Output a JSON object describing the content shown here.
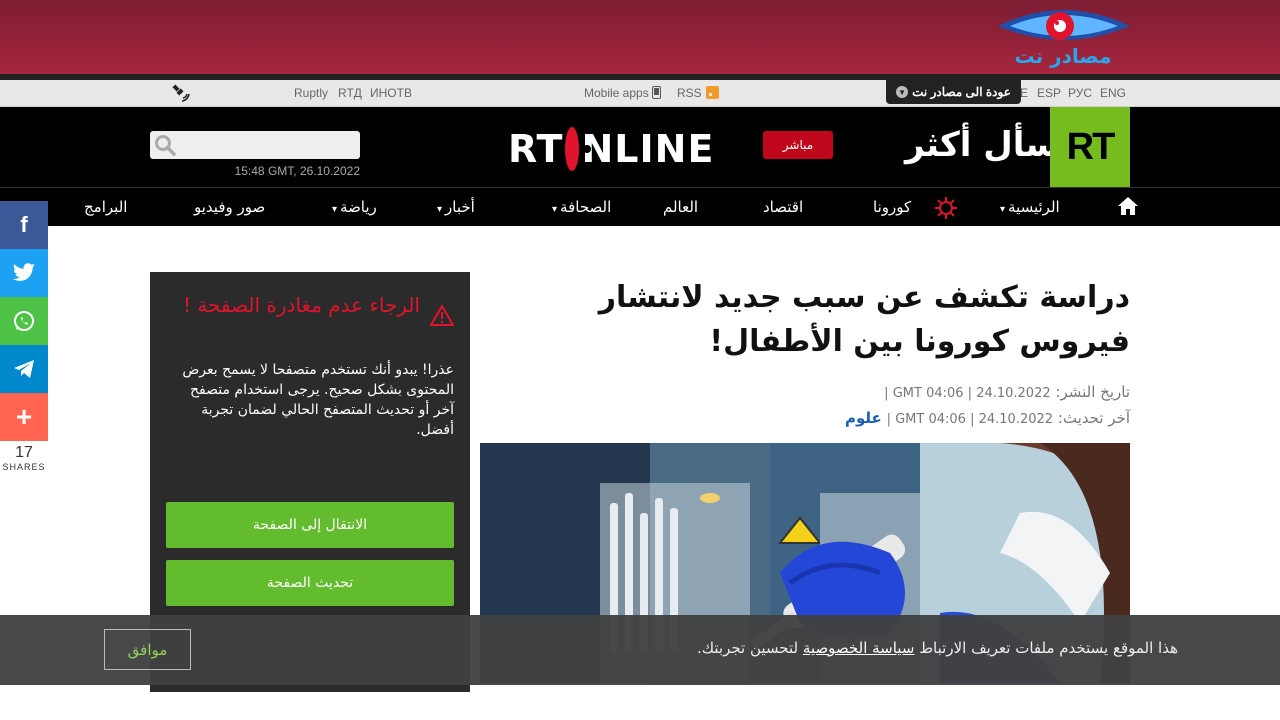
{
  "banner": {
    "logo_text": "مصادر نت"
  },
  "util": {
    "languages": [
      "ENG",
      "РУС",
      "ESP",
      "E"
    ],
    "back_label": "عودة الى مصادر نت",
    "rss": "RSS",
    "mobile_apps": "Mobile apps",
    "links": [
      "ИНОТВ",
      "RTД",
      "Ruptly"
    ]
  },
  "header": {
    "slogan": "اسأل أكثر",
    "rt_logo": "RT",
    "live_label": "مباشر",
    "online_left": "RT",
    "online_right": "NLINE",
    "datetime": "15:48 GMT, 26.10.2022",
    "search_placeholder": ""
  },
  "nav": {
    "items": [
      "الرئيسية",
      "كورونا",
      "اقتصاد",
      "العالم",
      "الصحافة",
      "أخبار",
      "رياضة",
      "صور وفيديو",
      "البرامج"
    ]
  },
  "share": {
    "count": "17",
    "label": "SHARES",
    "colors": {
      "facebook": "#3b5998",
      "twitter": "#1da1f2",
      "whatsapp": "#4dc247",
      "telegram": "#0088cc",
      "more": "#ff6550"
    }
  },
  "article": {
    "title": "دراسة تكشف عن سبب جديد لانتشار فيروس كورونا بين الأطفال!",
    "published_label": "تاريخ النشر:",
    "published_value": "24.10.2022 | 04:06 GMT |",
    "updated_label": "آخر تحديث:",
    "updated_value": "24.10.2022 | 04:06 GMT |",
    "tag": "علوم"
  },
  "warning": {
    "title": "الرجاء عدم مغادرة الصفحة !",
    "text": "عذرا! يبدو أنك تستخدم متصفحا لا يسمح بعرض المحتوى بشكل صحيح. يرجى استخدام متصفح آخر أو تحديث المتصفح الحالي لضمان تجربة أفضل.",
    "btn1": "الانتقال إلى الصفحة",
    "btn2": "تحديث الصفحة"
  },
  "cookie": {
    "text_before": "هذا الموقع يستخدم ملفات تعريف الارتباط",
    "link": "سياسة الخصوصية",
    "text_after": "لتحسين تجربتك.",
    "accept": "موافق"
  }
}
